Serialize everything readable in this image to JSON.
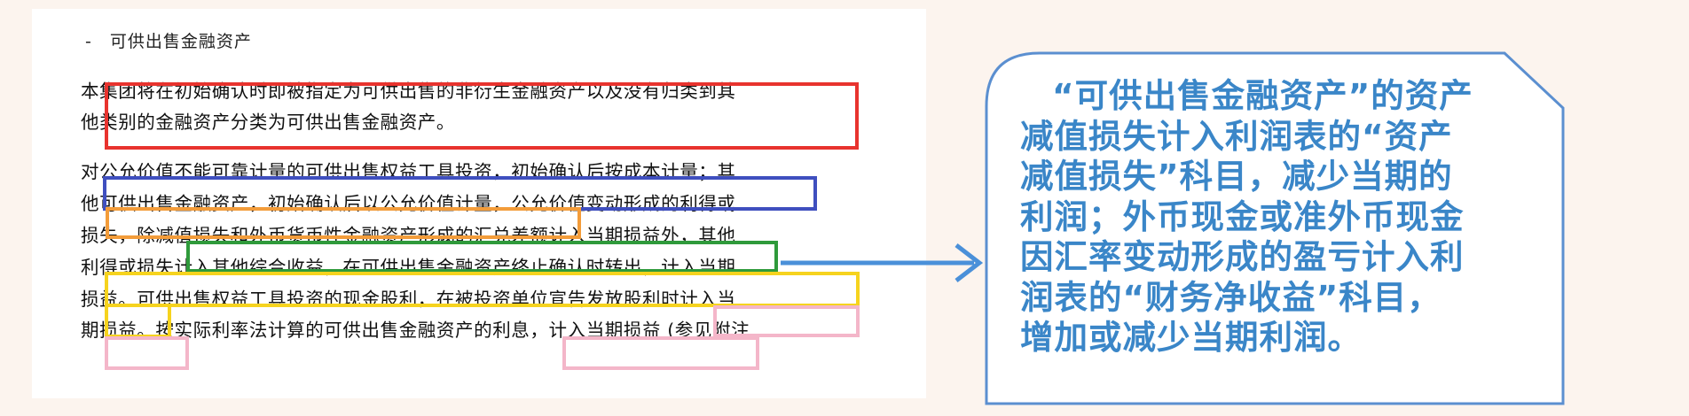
{
  "document": {
    "heading_dash": "-",
    "heading": "可供出售金融资产",
    "lines": [
      "本集团将在初始确认时即被指定为可供出售的非衍生金融资产以及没有归类到其",
      "他类别的金融资产分类为可供出售金融资产。",
      "对公允价值不能可靠计量的可供出售权益工具投资，初始确认后按成本计量；其",
      "他可供出售金融资产，初始确认后以公允价值计量，公允价值变动形成的利得或",
      "损失，除减值损失和外币货币性金融资产形成的汇兑差额计入当期损益外，其他",
      "利得或损失计入其他综合收益，在可供出售金融资产终止确认时转出，计入当期",
      "损益。可供出售权益工具投资的现金股利，在被投资单位宣告发放股利时计入当",
      "期损益。按实际利率法计算的可供出售金融资产的利息，计入当期损益 (参见附注"
    ]
  },
  "highlight_colors": {
    "red": "#e8332e",
    "blue": "#3f4fbf",
    "orange": "#f39c3a",
    "green": "#2f9a3b",
    "yellow": "#f6d31e",
    "pink": "#f4b6c9"
  },
  "callout": {
    "lines": [
      "“可供出售金融资产”的资产",
      "减值损失计入利润表的“资产",
      "减值损失”科目，减少当期的",
      "利润；外币现金或准外币现金",
      "因汇率变动形成的盈亏计入利",
      "润表的“财务净收益”科目，",
      "增加或减少当期利润。"
    ],
    "text_color": "#3a86c8",
    "border_color": "#5b8fd0"
  },
  "arrow_color": "#4a90d9"
}
